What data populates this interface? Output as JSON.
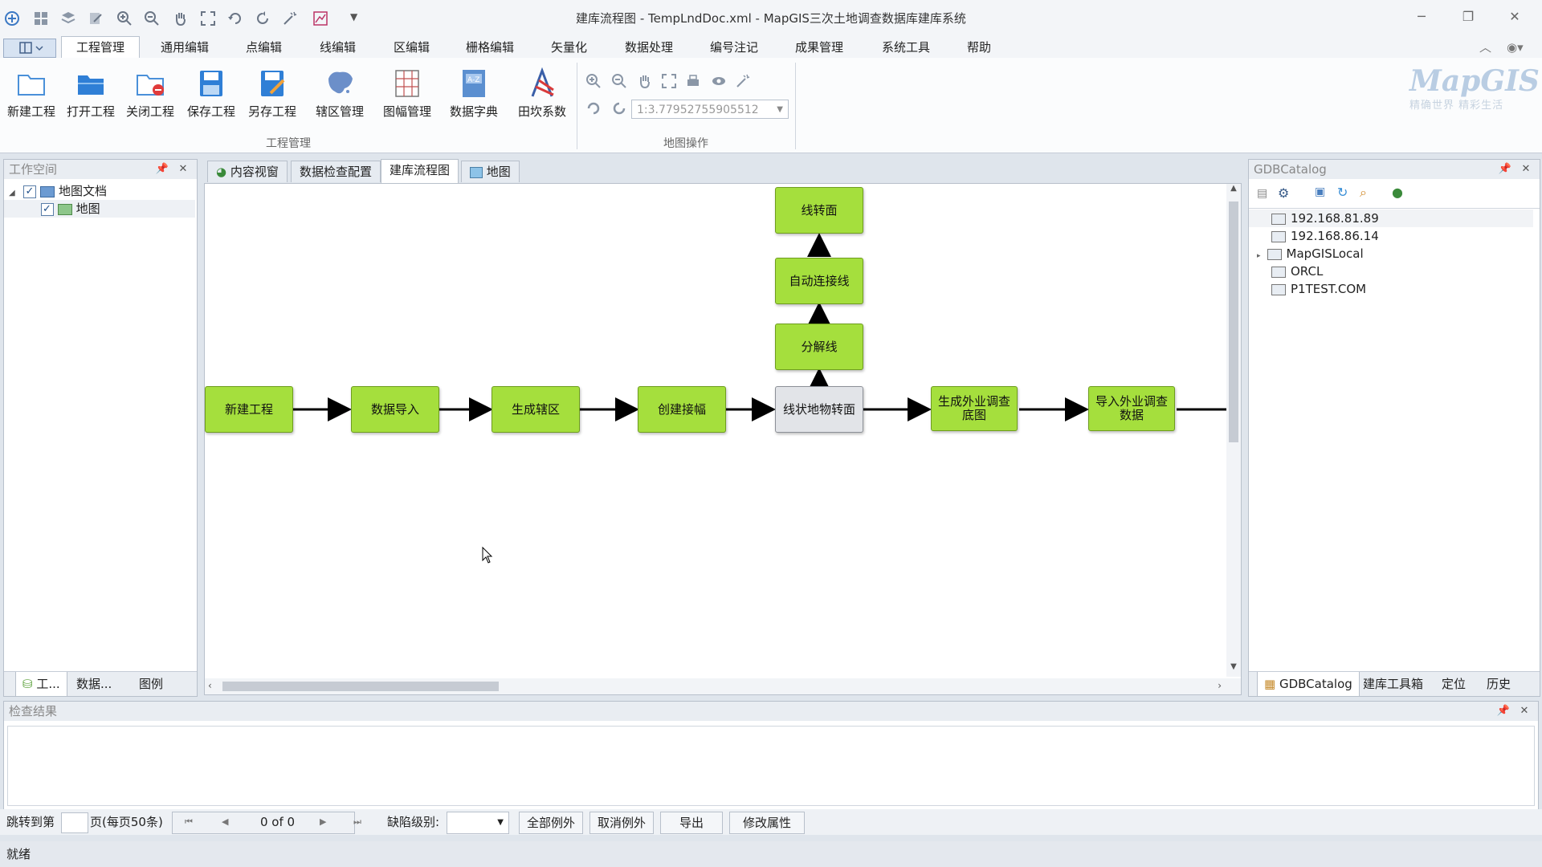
{
  "window": {
    "title": "建库流程图 - TempLndDoc.xml - MapGIS三次土地调查数据库建库系统"
  },
  "menu": {
    "tabs": [
      "工程管理",
      "通用编辑",
      "点编辑",
      "线编辑",
      "区编辑",
      "栅格编辑",
      "矢量化",
      "数据处理",
      "编号注记",
      "成果管理",
      "系统工具",
      "帮助"
    ]
  },
  "ribbon": {
    "buttons": [
      "新建工程",
      "打开工程",
      "关闭工程",
      "保存工程",
      "另存工程",
      "辖区管理",
      "图幅管理",
      "数据字典",
      "田坎系数"
    ],
    "group_project": "工程管理",
    "group_map": "地图操作",
    "scale_value": "1:3.77952755905512"
  },
  "logo": {
    "brand": "MapGIS",
    "slogan": "精确世界 精彩生活"
  },
  "workspace": {
    "title": "工作空间",
    "tree": [
      {
        "label": "地图文档"
      },
      {
        "label": "地图"
      }
    ],
    "bottom_tabs": [
      "工...",
      "数据...",
      "图例"
    ]
  },
  "doc_tabs": [
    "内容视窗",
    "数据检查配置",
    "建库流程图",
    "地图"
  ],
  "flow": {
    "nodes": [
      "新建工程",
      "数据导入",
      "生成辖区",
      "创建接幅",
      "线状地物转面",
      "生成外业调查底图",
      "导入外业调查数据",
      "分解线",
      "自动连接线",
      "线转面"
    ]
  },
  "catalog": {
    "title": "GDBCatalog",
    "items": [
      "192.168.81.89",
      "192.168.86.14",
      "MapGISLocal",
      "ORCL",
      "P1TEST.COM"
    ],
    "bottom_tabs": [
      "GDBCatalog",
      "建库工具箱",
      "定位",
      "历史"
    ]
  },
  "results": {
    "title": "检查结果",
    "jump_label": "跳转到第",
    "page_label": "页(每页50条)",
    "page_status": "0 of 0",
    "level_label": "缺陷级别:",
    "btn_all_except": "全部例外",
    "btn_cancel_except": "取消例外",
    "btn_export": "导出",
    "btn_modify": "修改属性"
  },
  "status": {
    "text": "就绪"
  }
}
